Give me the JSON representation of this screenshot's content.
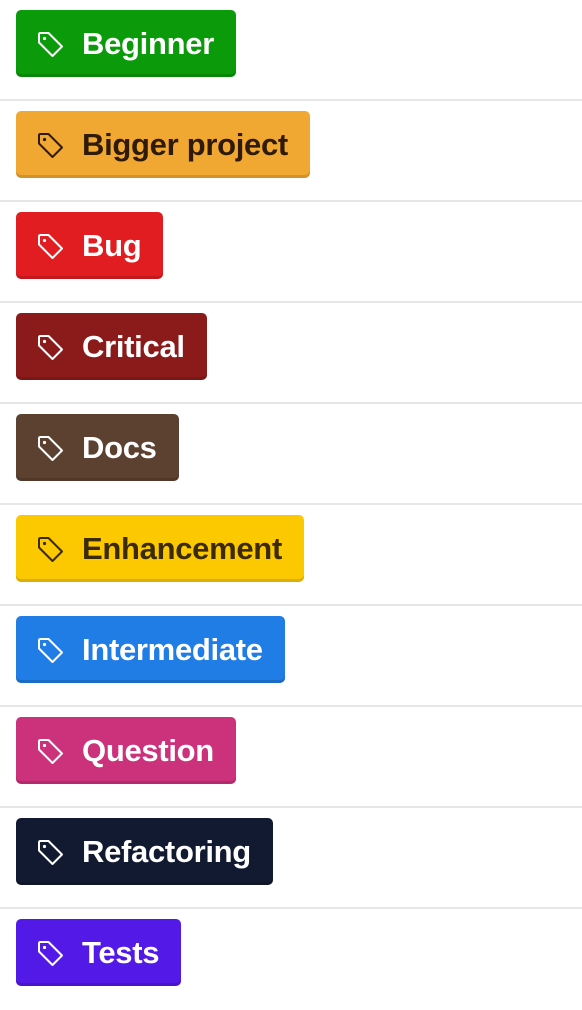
{
  "labels": [
    {
      "name": "Beginner",
      "bg": "#0a9a0a",
      "fg": "#ffffff",
      "icon": "tag-icon"
    },
    {
      "name": "Bigger project",
      "bg": "#f0a832",
      "fg": "#2e1a05",
      "icon": "tag-icon"
    },
    {
      "name": "Bug",
      "bg": "#e11d21",
      "fg": "#ffffff",
      "icon": "tag-icon"
    },
    {
      "name": "Critical",
      "bg": "#8b1a1a",
      "fg": "#ffffff",
      "icon": "tag-icon"
    },
    {
      "name": "Docs",
      "bg": "#5d4130",
      "fg": "#ffffff",
      "icon": "tag-icon"
    },
    {
      "name": "Enhancement",
      "bg": "#fcc800",
      "fg": "#3a2a05",
      "icon": "tag-icon"
    },
    {
      "name": "Intermediate",
      "bg": "#207de5",
      "fg": "#ffffff",
      "icon": "tag-icon"
    },
    {
      "name": "Question",
      "bg": "#cc317c",
      "fg": "#ffffff",
      "icon": "tag-icon"
    },
    {
      "name": "Refactoring",
      "bg": "#121a31",
      "fg": "#ffffff",
      "icon": "tag-icon"
    },
    {
      "name": "Tests",
      "bg": "#5319e7",
      "fg": "#ffffff",
      "icon": "tag-icon"
    }
  ]
}
